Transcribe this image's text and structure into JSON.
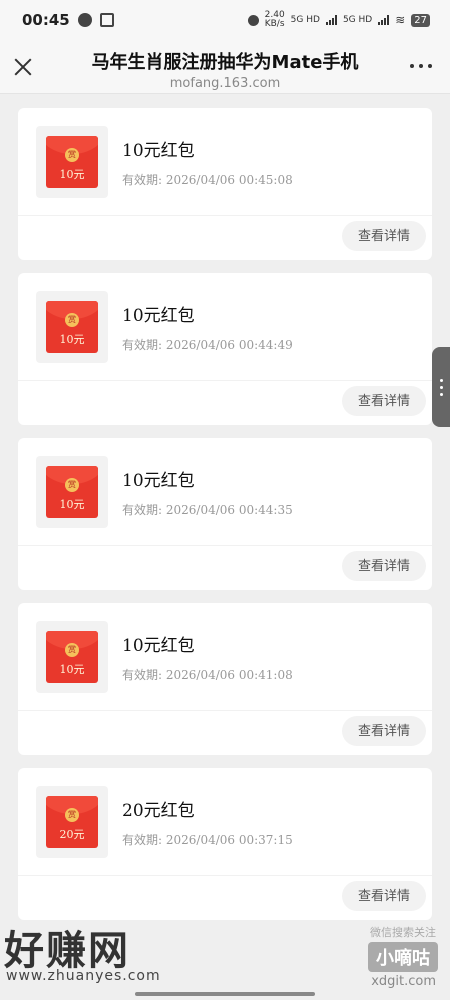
{
  "status_bar": {
    "time": "00:45",
    "speed": "2.40",
    "speed_unit": "KB/s",
    "net1": "5G HD",
    "net2": "5G HD",
    "battery": "27"
  },
  "header": {
    "title": "马年生肖服注册抽华为Mate手机",
    "url": "mofang.163.com"
  },
  "cards": [
    {
      "title": "10元红包",
      "amount_label": "10元",
      "expiry": "有效期: 2026/04/06 00:45:08",
      "button": "查看详情"
    },
    {
      "title": "10元红包",
      "amount_label": "10元",
      "expiry": "有效期: 2026/04/06 00:44:49",
      "button": "查看详情"
    },
    {
      "title": "10元红包",
      "amount_label": "10元",
      "expiry": "有效期: 2026/04/06 00:44:35",
      "button": "查看详情"
    },
    {
      "title": "10元红包",
      "amount_label": "10元",
      "expiry": "有效期: 2026/04/06 00:41:08",
      "button": "查看详情"
    },
    {
      "title": "20元红包",
      "amount_label": "20元",
      "expiry": "有效期: 2026/04/06 00:37:15",
      "button": "查看详情"
    }
  ],
  "seal_char": "赏",
  "watermark": {
    "left_logo": "好赚网",
    "left_url": "www.zhuanyes.com",
    "right_top": "微信搜索关注",
    "right_badge": "小嘀咕",
    "right_url": "xdgit.com"
  }
}
